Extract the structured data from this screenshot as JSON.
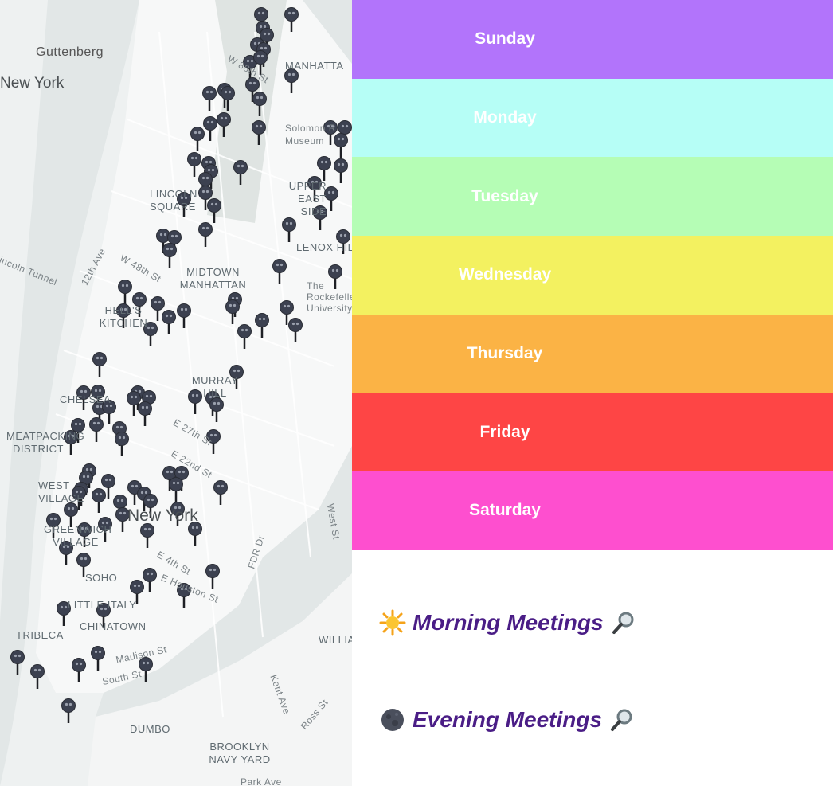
{
  "map": {
    "labels": {
      "guttenberg": "Guttenberg",
      "new_york_nj": "New York",
      "w88th": "W 88th St",
      "manhattan": "MANHATTA",
      "lincoln_square": "LINCOLN SQUARE",
      "upper_east_side": "UPPER EAST SIDE",
      "lenox_hill": "LENOX HILL",
      "lincoln_tunnel": "Lincoln Tunnel",
      "twelfth_ave": "12th Ave",
      "w48th": "W 48th St",
      "midtown": "MIDTOWN MANHATTAN",
      "hells_kitchen": "HELL'S KITCHEN",
      "murray_hill": "MURRAY HILL",
      "chelsea": "CHELSEA",
      "meatpacking": "MEATPACKING DISTRICT",
      "e27th": "E 27th St",
      "e22nd": "E 22nd St",
      "west_village": "WEST VILLAGE",
      "greenwich_village": "GREENWICH VILLAGE",
      "new_york_city": "New York",
      "soho": "SOHO",
      "little_italy": "LITTLE ITALY",
      "chinatown": "CHINATOWN",
      "tribeca": "TRIBECA",
      "madison_st": "Madison St",
      "south_st": "South St",
      "dumbo": "DUMBO",
      "brooklyn_navy_yard": "BROOKLYN NAVY YARD",
      "fdr_dr": "FDR Dr",
      "west_st": "West St",
      "kent_ave": "Kent Ave",
      "ross_st": "Ross St",
      "park_ave": "Park Ave",
      "e4th": "E 4th St",
      "houston": "E Houston St",
      "williamsburg": "WILLIA",
      "solomon": "Solomon R. Museum",
      "rockefeller": "The Rockefeller University"
    }
  },
  "days": [
    {
      "label": "Sunday",
      "color": "#b274fb"
    },
    {
      "label": "Monday",
      "color": "#b6fef6"
    },
    {
      "label": "Tuesday",
      "color": "#b5fdb5"
    },
    {
      "label": "Wednesday",
      "color": "#f3f160"
    },
    {
      "label": "Thursday",
      "color": "#fbb345"
    },
    {
      "label": "Friday",
      "color": "#fe4545"
    },
    {
      "label": "Saturday",
      "color": "#fe4fcf"
    }
  ],
  "meetings": {
    "morning": {
      "label": "Morning Meetings",
      "icon": "sun-icon",
      "search_icon": "magnifier-icon"
    },
    "evening": {
      "label": "Evening Meetings",
      "icon": "moon-icon",
      "search_icon": "magnifier-icon"
    }
  },
  "colors": {
    "meeting_text": "#4a1d86",
    "pin": "#3c4150"
  }
}
